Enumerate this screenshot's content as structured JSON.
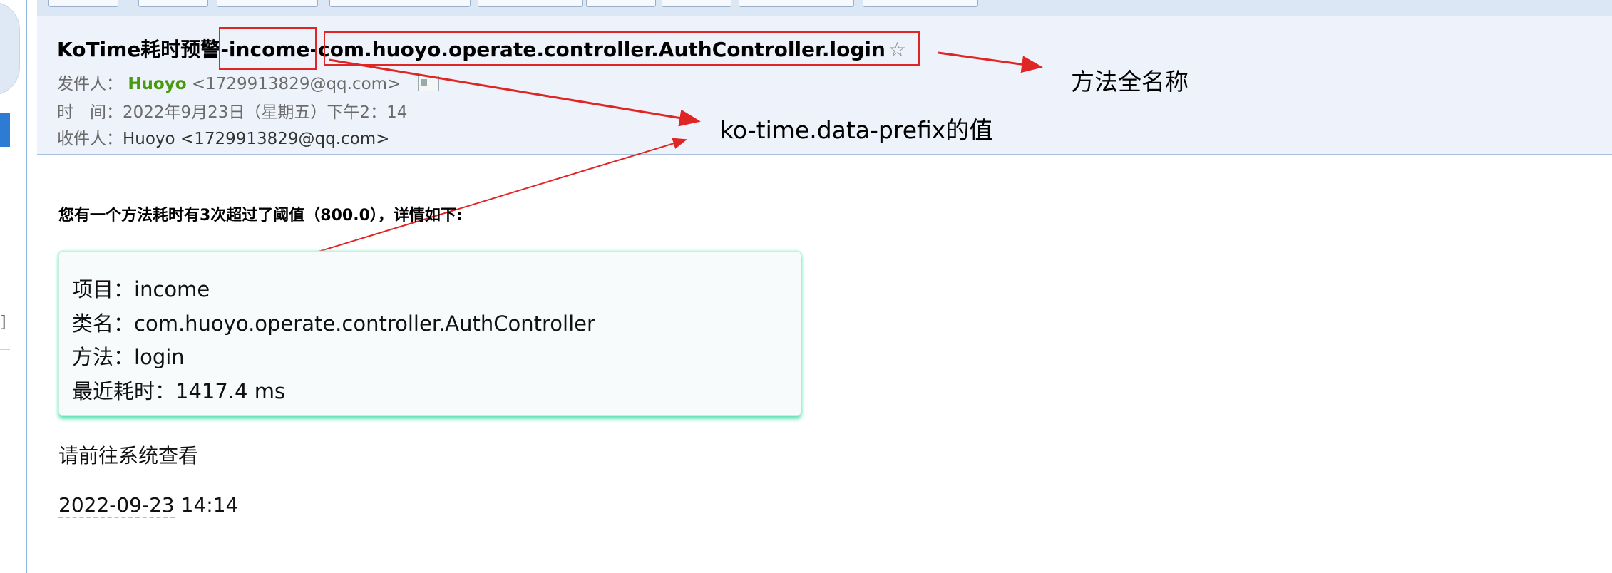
{
  "email": {
    "subject_prefix": "KoTime耗时预警",
    "subject_project": "-income-",
    "subject_method": "com.huoyo.operate.controller.AuthController.login",
    "star_glyph": "☆",
    "sender_label": "发件人：",
    "sender_name": "Huoyo",
    "sender_email": "<1729913829@qq.com>",
    "time_label": "时　间：",
    "time_value": "2022年9月23日（星期五）下午2：14",
    "recipient_label": "收件人：",
    "recipient_value": "Huoyo <1729913829@qq.com>"
  },
  "annotations": {
    "method_full_name": "方法全名称",
    "data_prefix_value": "ko-time.data-prefix的值"
  },
  "body": {
    "intro": "您有一个方法耗时有3次超过了阈值（800.0），详情如下:",
    "details": [
      {
        "label": "项目：",
        "value": "income"
      },
      {
        "label": "类名：",
        "value": "com.huoyo.operate.controller.AuthController"
      },
      {
        "label": "方法：",
        "value": "login"
      },
      {
        "label": "最近耗时：",
        "value": "1417.4 ms"
      }
    ],
    "go_check": "请前往系统查看",
    "date": "2022-09-23",
    "time": " 14:14"
  },
  "colors": {
    "annotation_red": "#e02525",
    "sender_green": "#4a9a0f",
    "header_bg": "#eef3fb",
    "box_shadow_green": "#5fe4b6"
  }
}
